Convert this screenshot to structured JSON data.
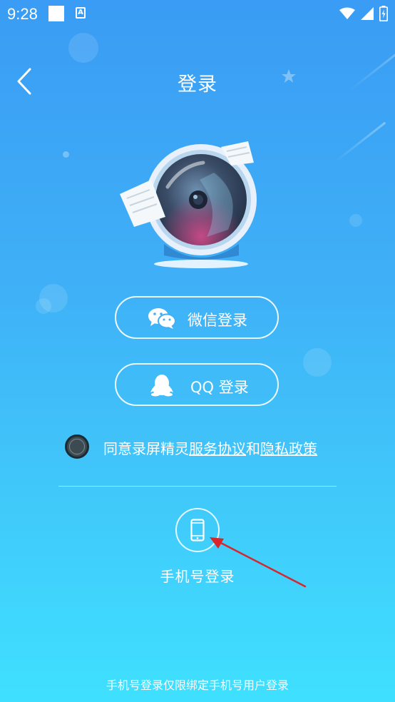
{
  "status_bar": {
    "time": "9:28",
    "icons": [
      "notification-square-icon",
      "a-keyboard-icon",
      "wifi-icon",
      "signal-icon",
      "battery-icon"
    ]
  },
  "header": {
    "title": "登录",
    "back_icon": "chevron-left-icon"
  },
  "logo": {
    "icon": "camera-lens-logo"
  },
  "login_options": {
    "wechat": {
      "label": "微信登录",
      "icon": "wechat-icon"
    },
    "qq": {
      "label": "QQ 登录",
      "icon": "qq-penguin-icon"
    }
  },
  "agreement": {
    "prefix": "同意录屏精灵",
    "service_link": "服务协议",
    "conjunction": "和",
    "privacy_link": "隐私政策",
    "checked": false
  },
  "phone_login": {
    "label": "手机号登录",
    "icon": "smartphone-icon"
  },
  "footer": {
    "note": "手机号登录仅限绑定手机号用户登录"
  },
  "annotation": {
    "arrow_color": "#d9262b"
  },
  "colors": {
    "background_top": "#3a9cf4",
    "background_bottom": "#3fe0ff",
    "text": "#ffffff"
  }
}
